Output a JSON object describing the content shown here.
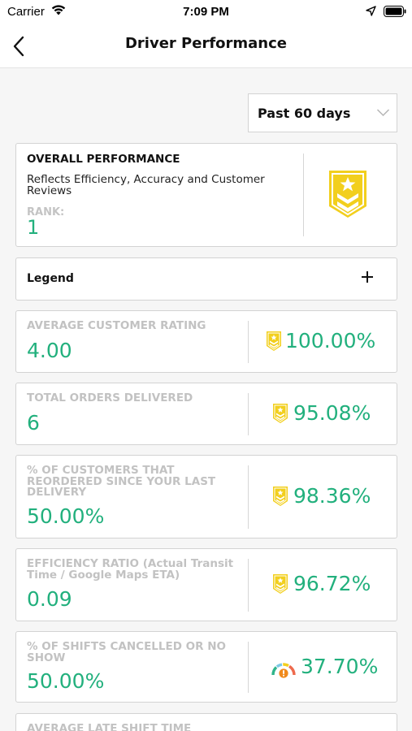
{
  "status_bar": {
    "carrier": "Carrier",
    "time": "7:09 PM"
  },
  "nav": {
    "title": "Driver Performance"
  },
  "period": {
    "selected": "Past 60 days"
  },
  "overall": {
    "heading": "OVERALL PERFORMANCE",
    "description": "Reflects Efficiency, Accuracy and Customer Reviews",
    "rank_label": "RANK:",
    "rank_value": "1"
  },
  "legend": {
    "title": "Legend"
  },
  "metrics": [
    {
      "label": "AVERAGE CUSTOMER RATING",
      "value": "4.00",
      "percent": "100.00%",
      "icon": "chevron-badge-icon"
    },
    {
      "label": "TOTAL ORDERS DELIVERED",
      "value": "6",
      "percent": "95.08%",
      "icon": "chevron-badge-icon"
    },
    {
      "label": "% OF CUSTOMERS THAT REORDERED SINCE YOUR LAST DELIVERY",
      "value": "50.00%",
      "percent": "98.36%",
      "icon": "chevron-badge-icon"
    },
    {
      "label": "EFFICIENCY RATIO (Actual Transit Time / Google Maps ETA)",
      "value": "0.09",
      "percent": "96.72%",
      "icon": "chevron-badge-icon"
    },
    {
      "label": "% OF SHIFTS CANCELLED OR NO SHOW",
      "value": "50.00%",
      "percent": "37.70%",
      "icon": "gauge-warning-icon"
    },
    {
      "label": "AVERAGE LATE SHIFT TIME",
      "value": "",
      "percent": "",
      "icon": ""
    }
  ],
  "colors": {
    "accent_green": "#22b07d",
    "badge_gold": "#f2cf1d",
    "muted_label": "#c2c2c2"
  }
}
